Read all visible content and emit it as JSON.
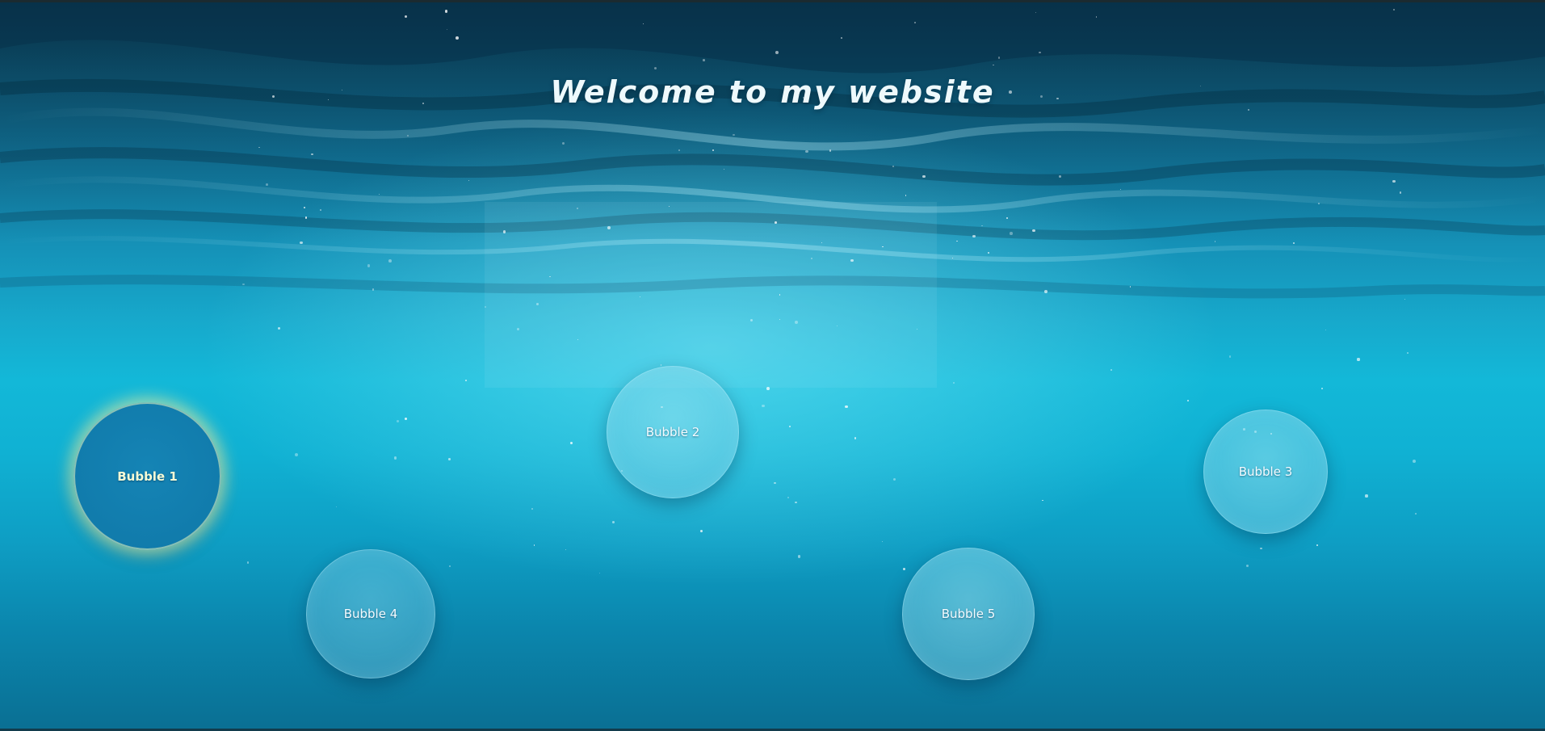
{
  "page": {
    "title": "Welcome to my website"
  },
  "bubbles": [
    {
      "label": "Bubble 1",
      "active": true
    },
    {
      "label": "Bubble 2",
      "active": false
    },
    {
      "label": "Bubble 3",
      "active": false
    },
    {
      "label": "Bubble 4",
      "active": false
    },
    {
      "label": "Bubble 5",
      "active": false
    }
  ],
  "colors": {
    "water_top": "#0b3f5a",
    "water_mid": "#13b8d8",
    "water_bottom": "#0a6f93",
    "active_glow": "#e1f5aa",
    "text": "#eef9fc"
  }
}
